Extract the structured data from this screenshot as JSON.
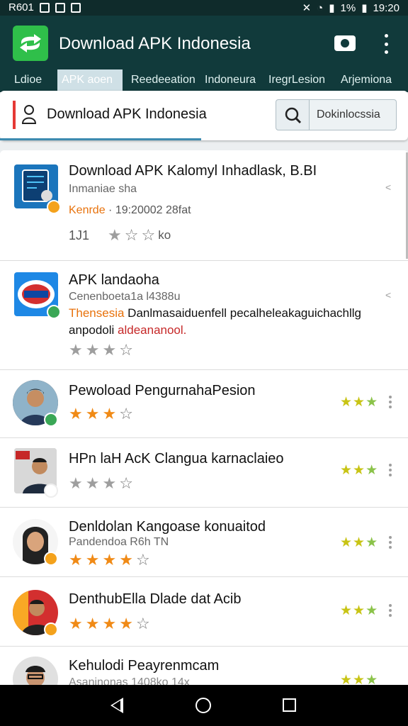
{
  "status_bar": {
    "left_text": "R601",
    "battery": "1%",
    "time": "19:20"
  },
  "app": {
    "title": "Download APK Indonesia"
  },
  "tabs": [
    {
      "label": "Ldioe"
    },
    {
      "label": "APK aoen"
    },
    {
      "label": "Reedeeation"
    },
    {
      "label": "Indoneura"
    },
    {
      "label": "IregrLesion"
    },
    {
      "label": "Arjemiona"
    }
  ],
  "search": {
    "title": "Download APK Indonesia",
    "placeholder": "Dokinlocssia"
  },
  "items": [
    {
      "name": "Download APK Kalomyl Inhadlask, B.BI",
      "sub": "Inmaniae sha",
      "meta_highlight": "Kenrde",
      "meta_rest": " · 19:20002 28fat",
      "stat_count": "1J1",
      "stat_tail": "ko"
    },
    {
      "name": "APK landaoha",
      "sub": "Cenenboeta1a l4388u",
      "desc_highlight": "Thensesia",
      "desc_rest": " Danlmasaiduenfell pecalheleakaguichachllg",
      "desc2_main": "anpodoli ",
      "desc2_red": "aldeananool."
    },
    {
      "name": "Pewoload PengurnahaPesion"
    },
    {
      "name": "HPn laH AcK Clangua karnaclaieo"
    },
    {
      "name": "Denldolan Kangoase konuaitod",
      "sub": "Pandendoa R6h TN"
    },
    {
      "name": "DenthubElla Dlade dat Acib"
    },
    {
      "name": "Kehulodi Peayrenmcam",
      "sub": "Asaninonas 1408ko 14x"
    }
  ],
  "colors": {
    "app_bar": "#113a3b",
    "accent_orange": "#f08a16",
    "accent_green": "#3aa756",
    "progress": "#3d8bb0"
  },
  "icons": [
    "search-icon",
    "camera-icon",
    "more-icon",
    "star-icon",
    "share-icon",
    "back-icon",
    "home-icon",
    "recents-icon"
  ]
}
